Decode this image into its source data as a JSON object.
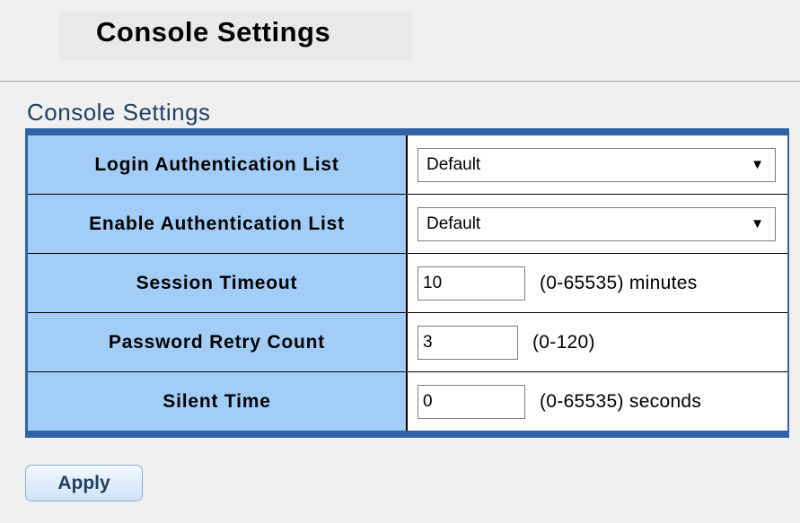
{
  "page": {
    "title": "Console Settings"
  },
  "section": {
    "title": "Console Settings"
  },
  "form": {
    "login_auth": {
      "label": "Login Authentication List",
      "value": "Default"
    },
    "enable_auth": {
      "label": "Enable Authentication List",
      "value": "Default"
    },
    "session_timeout": {
      "label": "Session Timeout",
      "value": "10",
      "hint": "(0-65535) minutes"
    },
    "password_retry": {
      "label": "Password Retry Count",
      "value": "3",
      "hint": "(0-120)"
    },
    "silent_time": {
      "label": "Silent Time",
      "value": "0",
      "hint": "(0-65535) seconds"
    }
  },
  "actions": {
    "apply_label": "Apply"
  },
  "icons": {
    "dropdown": "dropdown-caret-icon"
  },
  "colors": {
    "table_border": "#2f63a6",
    "label_bg": "#a2cdf6",
    "section_title": "#1f3f63"
  }
}
